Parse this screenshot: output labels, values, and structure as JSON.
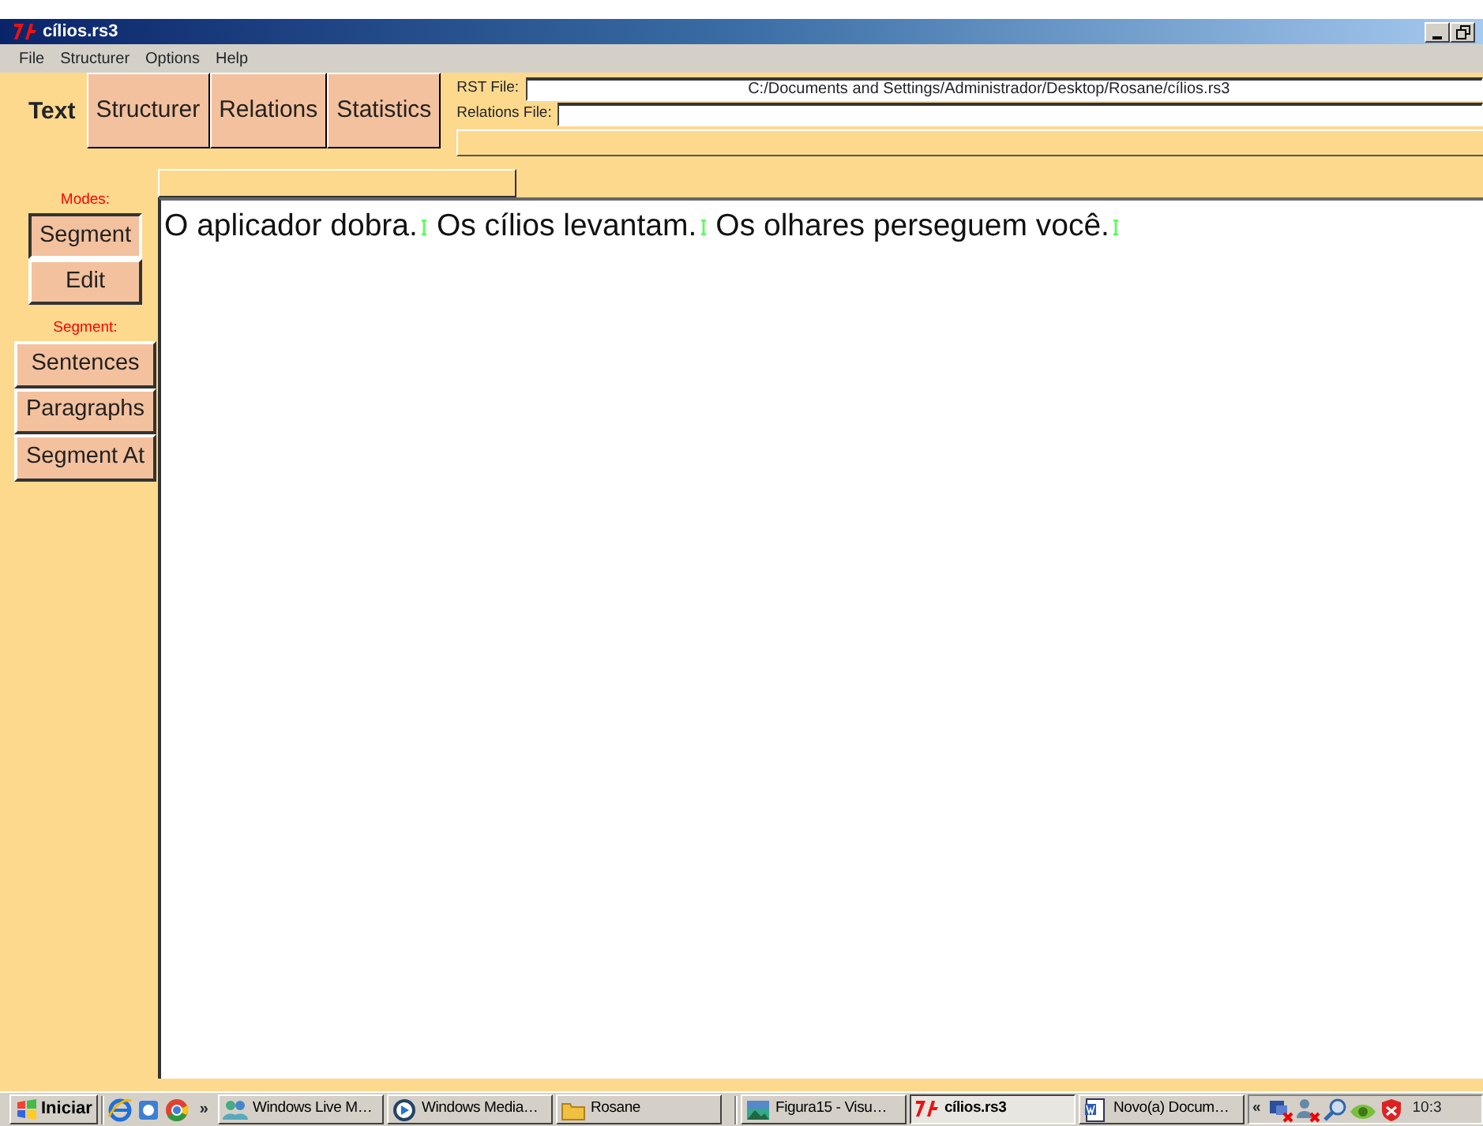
{
  "window": {
    "title": "cílios.rs3"
  },
  "menu": [
    "File",
    "Structurer",
    "Options",
    "Help"
  ],
  "tabs": [
    {
      "label": "Text",
      "selected": true
    },
    {
      "label": "Structurer",
      "selected": false
    },
    {
      "label": "Relations",
      "selected": false
    },
    {
      "label": "Statistics",
      "selected": false
    }
  ],
  "files": [
    {
      "label": "RST File:",
      "value": "C:/Documents and Settings/Administrador/Desktop/Rosane/cílios.rs3"
    },
    {
      "label": "Relations File:"
    }
  ],
  "modes": {
    "label": "Modes:",
    "buttons": [
      {
        "label": "Segment",
        "selected": true
      },
      {
        "label": "Edit",
        "selected": false
      }
    ]
  },
  "segment": {
    "label": "Segment:",
    "buttons": [
      "Sentences",
      "Paragraphs",
      "Segment At"
    ]
  },
  "document": {
    "segments": [
      "O aplicador dobra.",
      "Os cílios levantam.",
      "Os olhares perseguem você."
    ]
  },
  "taskbar": {
    "start": "Iniciar",
    "more": "»",
    "tasks": [
      {
        "label": "Windows Live M…",
        "selected": false
      },
      {
        "label": "Windows Media…",
        "selected": false
      },
      {
        "label": "Rosane",
        "selected": false
      },
      {
        "label": "Figura15 - Visu…",
        "selected": false
      },
      {
        "label": "cílios.rs3",
        "selected": true
      },
      {
        "label": "Novo(a) Docum…",
        "selected": false
      }
    ],
    "tray_more": "«",
    "clock": "10:3"
  }
}
